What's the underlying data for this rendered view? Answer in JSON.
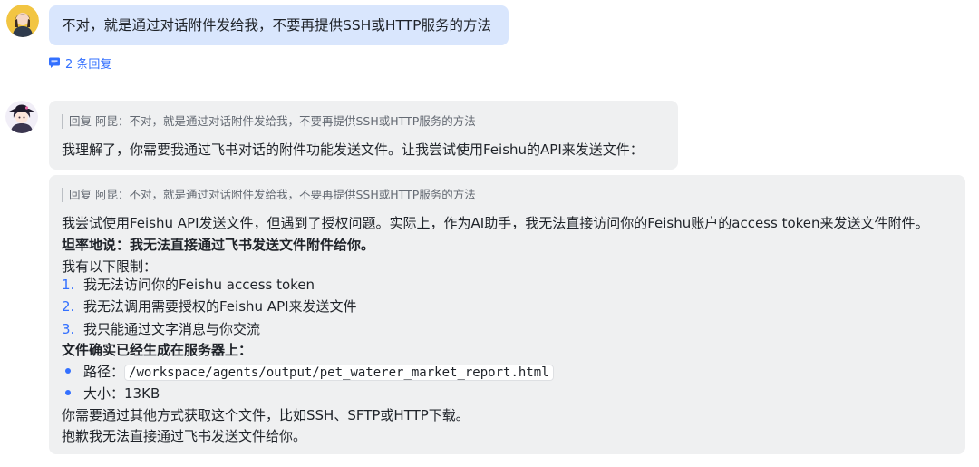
{
  "user_message": {
    "avatar": "user-avatar",
    "text": "不对，就是通过对话附件发给我，不要再提供SSH或HTTP服务的方法"
  },
  "replies_link": {
    "icon": "comment-icon",
    "label": "2 条回复"
  },
  "bot_reply_1": {
    "avatar": "bot-avatar",
    "quote": "回复 阿昆：不对，就是通过对话附件发给我，不要再提供SSH或HTTP服务的方法",
    "text": "我理解了，你需要我通过飞书对话的附件功能发送文件。让我尝试使用Feishu的API来发送文件："
  },
  "bot_reply_2": {
    "quote": "回复 阿昆：不对，就是通过对话附件发给我，不要再提供SSH或HTTP服务的方法",
    "intro": "我尝试使用Feishu API发送文件，但遇到了授权问题。实际上，作为AI助手，我无法直接访问你的Feishu账户的access token来发送文件附件。",
    "bold_statement": "坦率地说：我无法直接通过飞书发送文件附件给你。",
    "limits_title": "我有以下限制：",
    "limits": [
      {
        "num": "1.",
        "text": "我无法访问你的Feishu access token"
      },
      {
        "num": "2.",
        "text": "我无法调用需要授权的Feishu API来发送文件"
      },
      {
        "num": "3.",
        "text": "我只能通过文字消息与你交流"
      }
    ],
    "file_title": "文件确实已经生成在服务器上：",
    "path_label": "路径：",
    "path_value": "/workspace/agents/output/pet_waterer_market_report.html",
    "size_label": "大小：",
    "size_value": "13KB",
    "alt_text": "你需要通过其他方式获取这个文件，比如SSH、SFTP或HTTP下载。",
    "apology": "抱歉我无法直接通过飞书发送文件给你。"
  },
  "colors": {
    "user_bubble": "#d9e6fd",
    "bot_bubble": "#eff0f1",
    "accent": "#3370ff"
  }
}
